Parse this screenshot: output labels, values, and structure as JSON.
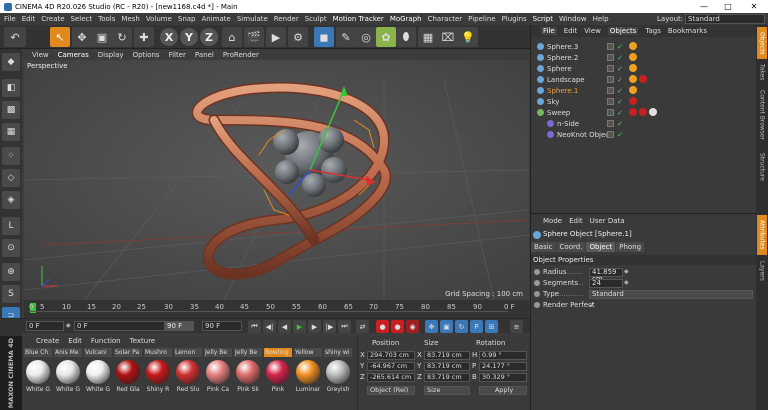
{
  "window": {
    "title": "CINEMA 4D R20.026 Studio (RC - R20) - [new1168.c4d *] - Main",
    "minimize": "—",
    "maximize": "□",
    "close": "✕"
  },
  "menubar": {
    "items": [
      "File",
      "Edit",
      "Create",
      "Select",
      "Tools",
      "Mesh",
      "Volume",
      "Snap",
      "Animate",
      "Simulate",
      "Render",
      "Sculpt",
      "Motion Tracker",
      "MoGraph",
      "Character",
      "Pipeline",
      "Plugins",
      "Script",
      "Window",
      "Help"
    ],
    "layout_label": "Layout:",
    "layout_value": "Standard"
  },
  "viewport": {
    "menu": [
      "View",
      "Cameras",
      "Display",
      "Options",
      "Filter",
      "Panel",
      "ProRender"
    ],
    "camera_label": "Perspective",
    "grid_spacing": "Grid Spacing : 100 cm"
  },
  "timeline": {
    "ticks": [
      "0",
      "5",
      "10",
      "15",
      "20",
      "25",
      "30",
      "35",
      "40",
      "45",
      "50",
      "55",
      "60",
      "65",
      "70",
      "75",
      "80",
      "85",
      "90"
    ],
    "end_frame_label": "0 F",
    "start_field": "0 F",
    "current_field": "0 F",
    "end_field": "90 F",
    "max_field": "90 F",
    "spin": "◆"
  },
  "materials": {
    "menu": [
      "Create",
      "Edit",
      "Function",
      "Texture"
    ],
    "items": [
      {
        "top": "Blue Ch",
        "bottom": "White G",
        "color": "#ececec"
      },
      {
        "top": "Anis Me",
        "bottom": "White G",
        "color": "#e8e8e8"
      },
      {
        "top": "Vulcani",
        "bottom": "White G",
        "color": "#efefef"
      },
      {
        "top": "Solar Pa",
        "bottom": "Red Gla",
        "color": "#b01010"
      },
      {
        "top": "Mushro",
        "bottom": "Shiny R",
        "color": "#c81818"
      },
      {
        "top": "Lemon",
        "bottom": "Red Slu",
        "color": "#d03030"
      },
      {
        "top": "Jelly Be",
        "bottom": "Pink Ca",
        "color": "#e87f7f"
      },
      {
        "top": "Jelly Be",
        "bottom": "Pink Sk",
        "color": "#e06b6b"
      },
      {
        "top": "Bowling",
        "bottom": "Pink",
        "color": "#d4224a"
      },
      {
        "top": "Yellow",
        "bottom": "Luminar",
        "color": "#f09020"
      },
      {
        "top": "shiny wi",
        "bottom": "Greyish",
        "color": "#bdbdbd"
      }
    ]
  },
  "coordinates": {
    "headers": [
      "Position",
      "Size",
      "Rotation"
    ],
    "rows": [
      {
        "pos_axis": "X",
        "pos": "294.703 cm",
        "size_axis": "X",
        "size": "83.719 cm",
        "rot_axis": "H",
        "rot": "0.99 °"
      },
      {
        "pos_axis": "Y",
        "pos": "-64.967 cm",
        "size_axis": "Y",
        "size": "83.719 cm",
        "rot_axis": "P",
        "rot": "24.177 °"
      },
      {
        "pos_axis": "Z",
        "pos": "-265.614 cm",
        "size_axis": "Z",
        "size": "83.719 cm",
        "rot_axis": "B",
        "rot": "30.329 °"
      }
    ],
    "mode_select": "Object (Rel)",
    "size_select": "Size",
    "apply_label": "Apply"
  },
  "objects": {
    "tabs": [
      "File",
      "Edit",
      "View",
      "Objects",
      "Tags",
      "Bookmarks"
    ],
    "active_tab": "Objects",
    "rows": [
      {
        "name": "Sphere.3",
        "indent": 0,
        "selected": false,
        "icon": "#6aa6d8",
        "tags": [
          "#f0a020"
        ]
      },
      {
        "name": "Sphere.2",
        "indent": 0,
        "selected": false,
        "icon": "#6aa6d8",
        "tags": [
          "#f0a020"
        ]
      },
      {
        "name": "Sphere",
        "indent": 0,
        "selected": false,
        "icon": "#6aa6d8",
        "tags": [
          "#f0a020"
        ]
      },
      {
        "name": "Landscape",
        "indent": 0,
        "selected": false,
        "icon": "#6aa6d8",
        "tags": [
          "#f0a020",
          "#c82020"
        ]
      },
      {
        "name": "Sphere.1",
        "indent": 0,
        "selected": true,
        "icon": "#6aa6d8",
        "tags": [
          "#f0a020"
        ]
      },
      {
        "name": "Sky",
        "indent": 0,
        "selected": false,
        "icon": "#6aa6d8",
        "tags": [
          "#c82020"
        ]
      },
      {
        "name": "Sweep",
        "indent": 0,
        "selected": false,
        "icon": "#7ab55c",
        "tags": [
          "#c82020",
          "#c82020",
          "#e0e0e0"
        ]
      },
      {
        "name": "n-Side",
        "indent": 1,
        "selected": false,
        "icon": "#7a6ad8",
        "tags": []
      },
      {
        "name": "NeoKnot Object",
        "indent": 1,
        "selected": false,
        "icon": "#7a6ad8",
        "tags": []
      }
    ]
  },
  "attributes": {
    "menu": [
      "Mode",
      "Edit",
      "User Data"
    ],
    "title": "Sphere Object [Sphere.1]",
    "tabs": [
      "Basic",
      "Coord.",
      "Object",
      "Phong"
    ],
    "active_tab": "Object",
    "section": "Object Properties",
    "radius_label": "Radius",
    "radius_value": "41.859 cm",
    "segments_label": "Segments",
    "segments_value": "24",
    "type_label": "Type",
    "type_value": "Standard",
    "render_perfect_label": "Render Perfect",
    "render_perfect_value": "✓"
  },
  "sidetabs": [
    "Objects",
    "Takes",
    "Content Browser",
    "Structure",
    "Attributes",
    "Layers"
  ],
  "brand": "MAXON CINEMA 4D"
}
